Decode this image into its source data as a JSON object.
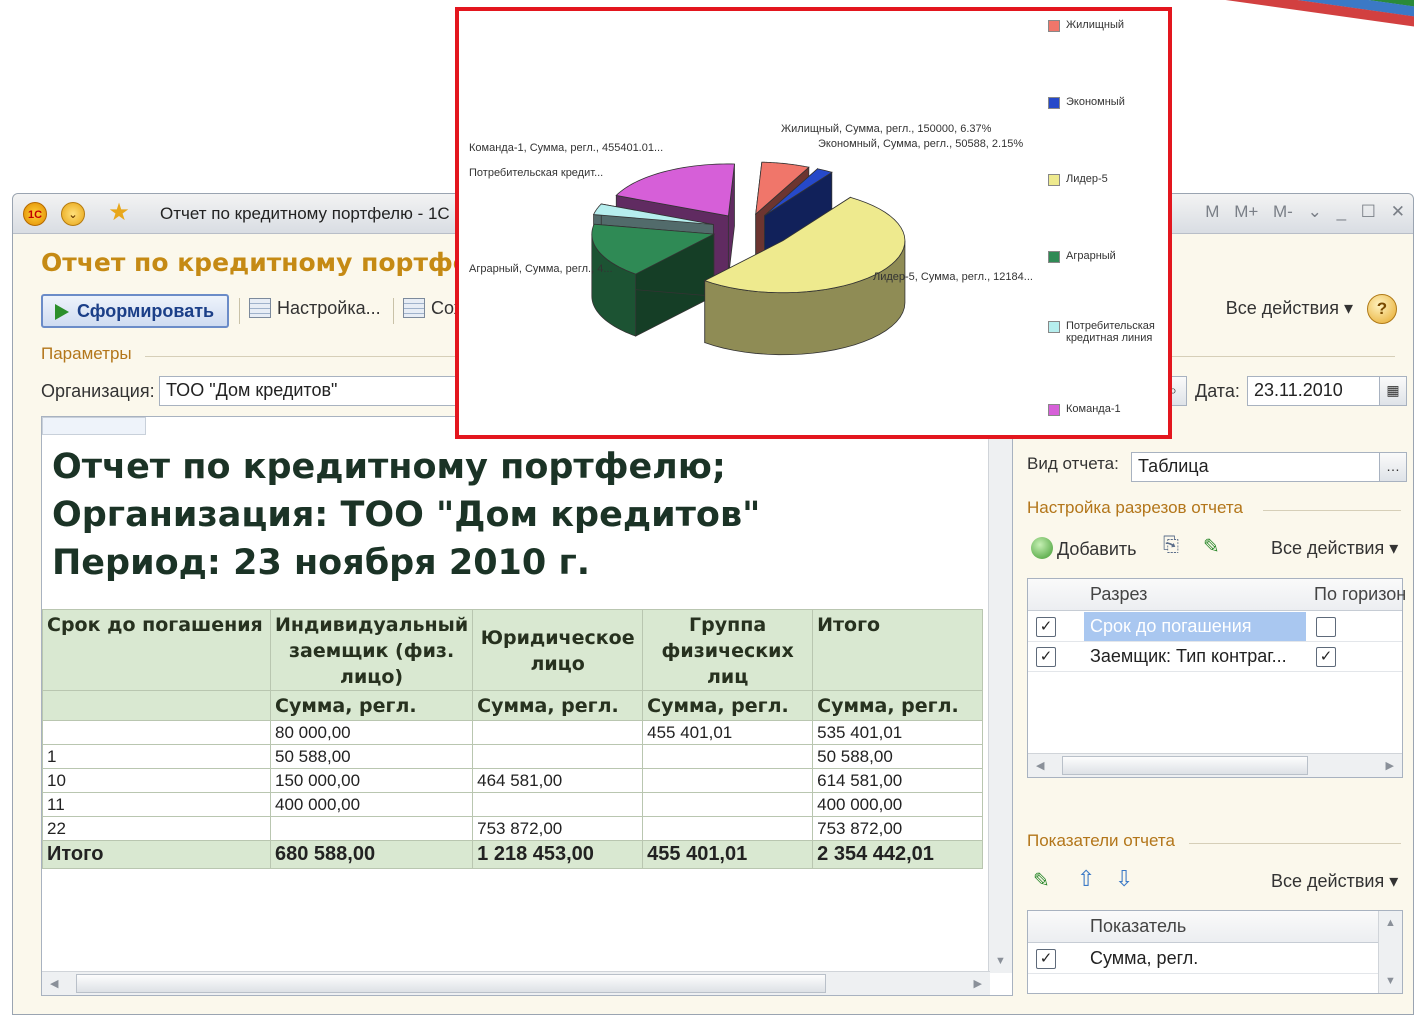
{
  "window": {
    "title": "Отчет по кредитному портфелю - 1С",
    "memory_buttons": [
      "M",
      "M+",
      "M-"
    ]
  },
  "form": {
    "title": "Отчет по кредитному портфелю",
    "toolbar": {
      "generate_label": "Сформировать",
      "settings_label": "Настройка...",
      "save_label": "Сох",
      "all_actions_label": "Все действия",
      "help_label": "?"
    },
    "params_label": "Параметры",
    "org_label": "Организация:",
    "org_value": "ТОО \"Дом кредитов\"",
    "date_label": "Дата:",
    "date_value": "23.11.2010"
  },
  "report": {
    "heading_line1": "Отчет по кредитному портфелю;",
    "heading_line2": "Организация: ТОО \"Дом кредитов\"",
    "heading_line3": "Период: 23 ноября 2010 г.",
    "col_headers": [
      "Срок до погашения",
      "Индивидуальный заемщик (физ. лицо)",
      "Юридическое лицо",
      "Группа физических лиц",
      "Итого"
    ],
    "sub_header": "Сумма, регл.",
    "rows": [
      [
        "",
        "80 000,00",
        "",
        "455 401,01",
        "535 401,01"
      ],
      [
        "1",
        "50 588,00",
        "",
        "",
        "50 588,00"
      ],
      [
        "10",
        "150 000,00",
        "464 581,00",
        "",
        "614 581,00"
      ],
      [
        "11",
        "400 000,00",
        "",
        "",
        "400 000,00"
      ],
      [
        "22",
        "",
        "753 872,00",
        "",
        "753 872,00"
      ]
    ],
    "total_row": [
      "Итого",
      "680 588,00",
      "1 218 453,00",
      "455 401,01",
      "2 354 442,01"
    ]
  },
  "right_panel": {
    "report_kind_label": "Вид отчета:",
    "report_kind_value": "Таблица",
    "cuts_label": "Настройка разрезов отчета",
    "add_label": "Добавить",
    "all_actions_label": "Все действия",
    "cuts_headers": [
      "Разрез",
      "По горизон"
    ],
    "cuts_rows": [
      {
        "name": "Срок до погашения",
        "checked": true,
        "horizontal": false,
        "selected": true
      },
      {
        "name": "Заемщик: Тип контраг...",
        "checked": true,
        "horizontal": true,
        "selected": false
      }
    ],
    "indicators_label": "Показатели отчета",
    "indicators_all_actions_label": "Все действия",
    "indicators_header": "Показатель",
    "indicators_rows": [
      {
        "name": "Сумма, регл.",
        "checked": true
      }
    ]
  },
  "chart_data": {
    "type": "pie",
    "title": "",
    "series": [
      {
        "name": "Жилищный",
        "label": "Жилищный, Сумма, регл., 150000, 6.37%",
        "value": 150000,
        "percent": 6.37,
        "color": "#f0766a"
      },
      {
        "name": "Экономный",
        "label": "Экономный, Сумма, регл., 50588, 2.15%",
        "value": 50588,
        "percent": 2.15,
        "color": "#2649c9"
      },
      {
        "name": "Лидер-5",
        "label": "Лидер-5, Сумма, регл., 12184...",
        "value": 1218453,
        "percent": 51.75,
        "color": "#eeea8e"
      },
      {
        "name": "Аграрный",
        "label": "Аграрный, Сумма, регл., 4...",
        "value": 400000,
        "percent": 16.99,
        "color": "#2f8a55"
      },
      {
        "name": "Потребительская кредитная линия",
        "label": "Потребительская кредит...",
        "value": 80000,
        "percent": 3.4,
        "color": "#b6eeee"
      },
      {
        "name": "Команда-1",
        "label": "Команда-1, Сумма, регл., 455401.01...",
        "value": 455401.01,
        "percent": 19.34,
        "color": "#d65fd8"
      }
    ],
    "legend_labels": [
      "Жилищный",
      "Экономный",
      "Лидер-5",
      "Аграрный",
      "Потребительская кредитная линия",
      "Команда-1"
    ],
    "legend_placement": "right"
  }
}
